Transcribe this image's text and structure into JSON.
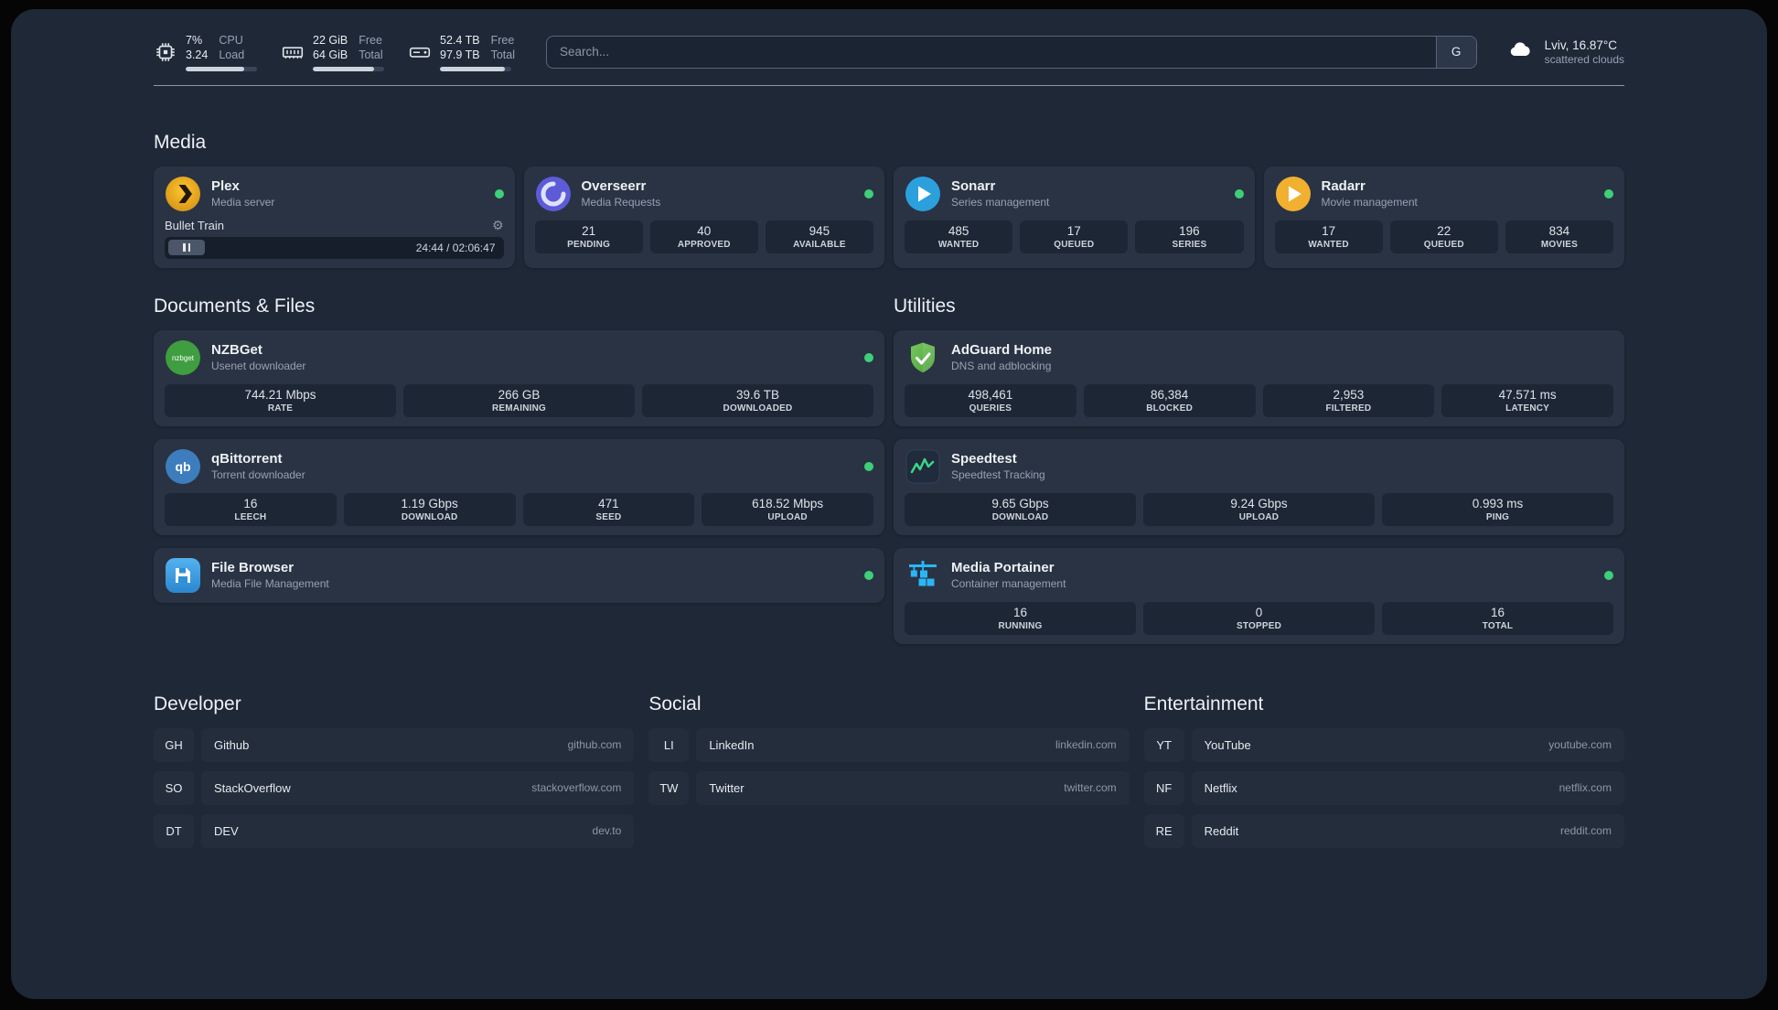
{
  "topbar": {
    "cpu": {
      "value": "7%",
      "load": "3.24",
      "label_top": "CPU",
      "label_bottom": "Load",
      "progress": 82
    },
    "memory": {
      "free": "22 GiB",
      "total": "64 GiB",
      "label_top": "Free",
      "label_bottom": "Total",
      "progress": 86
    },
    "disk": {
      "free": "52.4 TB",
      "total": "97.9 TB",
      "label_top": "Free",
      "label_bottom": "Total",
      "progress": 91
    },
    "search": {
      "placeholder": "Search...",
      "provider_button": "G"
    },
    "weather": {
      "location": "Lviv, 16.87°C",
      "condition": "scattered clouds"
    }
  },
  "sections": {
    "media": {
      "title": "Media",
      "cards": [
        {
          "title": "Plex",
          "subtitle": "Media server",
          "status": "online",
          "player": {
            "track": "Bullet Train",
            "time": "24:44 / 02:06:47"
          }
        },
        {
          "title": "Overseerr",
          "subtitle": "Media Requests",
          "status": "online",
          "stats": [
            {
              "value": "21",
              "label": "PENDING"
            },
            {
              "value": "40",
              "label": "APPROVED"
            },
            {
              "value": "945",
              "label": "AVAILABLE"
            }
          ]
        },
        {
          "title": "Sonarr",
          "subtitle": "Series management",
          "status": "online",
          "stats": [
            {
              "value": "485",
              "label": "WANTED"
            },
            {
              "value": "17",
              "label": "QUEUED"
            },
            {
              "value": "196",
              "label": "SERIES"
            }
          ]
        },
        {
          "title": "Radarr",
          "subtitle": "Movie management",
          "status": "online",
          "stats": [
            {
              "value": "17",
              "label": "WANTED"
            },
            {
              "value": "22",
              "label": "QUEUED"
            },
            {
              "value": "834",
              "label": "MOVIES"
            }
          ]
        }
      ]
    },
    "documents": {
      "title": "Documents & Files",
      "cards": [
        {
          "title": "NZBGet",
          "subtitle": "Usenet downloader",
          "status": "online",
          "stats": [
            {
              "value": "744.21 Mbps",
              "label": "RATE"
            },
            {
              "value": "266 GB",
              "label": "REMAINING"
            },
            {
              "value": "39.6 TB",
              "label": "DOWNLOADED"
            }
          ]
        },
        {
          "title": "qBittorrent",
          "subtitle": "Torrent downloader",
          "status": "online",
          "stats": [
            {
              "value": "16",
              "label": "LEECH"
            },
            {
              "value": "1.19 Gbps",
              "label": "DOWNLOAD"
            },
            {
              "value": "471",
              "label": "SEED"
            },
            {
              "value": "618.52 Mbps",
              "label": "UPLOAD"
            }
          ]
        },
        {
          "title": "File Browser",
          "subtitle": "Media File Management",
          "status": "online"
        }
      ]
    },
    "utilities": {
      "title": "Utilities",
      "cards": [
        {
          "title": "AdGuard Home",
          "subtitle": "DNS and adblocking",
          "stats": [
            {
              "value": "498,461",
              "label": "QUERIES"
            },
            {
              "value": "86,384",
              "label": "BLOCKED"
            },
            {
              "value": "2,953",
              "label": "FILTERED"
            },
            {
              "value": "47.571 ms",
              "label": "LATENCY"
            }
          ]
        },
        {
          "title": "Speedtest",
          "subtitle": "Speedtest Tracking",
          "stats": [
            {
              "value": "9.65 Gbps",
              "label": "DOWNLOAD"
            },
            {
              "value": "9.24 Gbps",
              "label": "UPLOAD"
            },
            {
              "value": "0.993 ms",
              "label": "PING"
            }
          ]
        },
        {
          "title": "Media Portainer",
          "subtitle": "Container management",
          "status": "online",
          "stats": [
            {
              "value": "16",
              "label": "RUNNING"
            },
            {
              "value": "0",
              "label": "STOPPED"
            },
            {
              "value": "16",
              "label": "TOTAL"
            }
          ]
        }
      ]
    },
    "bookmarks": [
      {
        "title": "Developer",
        "items": [
          {
            "abbr": "GH",
            "name": "Github",
            "url": "github.com"
          },
          {
            "abbr": "SO",
            "name": "StackOverflow",
            "url": "stackoverflow.com"
          },
          {
            "abbr": "DT",
            "name": "DEV",
            "url": "dev.to"
          }
        ]
      },
      {
        "title": "Social",
        "items": [
          {
            "abbr": "LI",
            "name": "LinkedIn",
            "url": "linkedin.com"
          },
          {
            "abbr": "TW",
            "name": "Twitter",
            "url": "twitter.com"
          }
        ]
      },
      {
        "title": "Entertainment",
        "items": [
          {
            "abbr": "YT",
            "name": "YouTube",
            "url": "youtube.com"
          },
          {
            "abbr": "NF",
            "name": "Netflix",
            "url": "netflix.com"
          },
          {
            "abbr": "RE",
            "name": "Reddit",
            "url": "reddit.com"
          }
        ]
      }
    ]
  },
  "colors": {
    "status_online": "#3ecf79",
    "plex": "#e5a00d",
    "overseerr": "#5e5bd8",
    "sonarr": "#2ba0dd",
    "radarr": "#f1b02f",
    "nzbget": "#3f9e3f",
    "qbittorrent": "#3d7dbd",
    "adguard": "#68c14e",
    "speedtest_line": "#3bd689",
    "portainer": "#2ab6f6"
  }
}
